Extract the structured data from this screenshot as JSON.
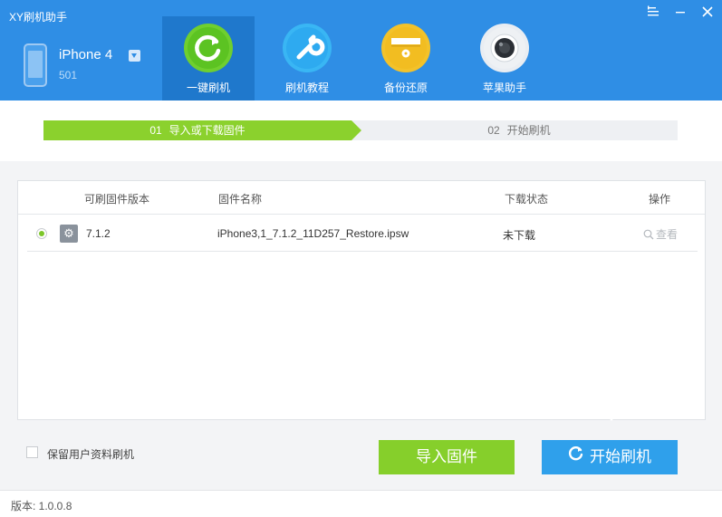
{
  "app": {
    "title": "XY刷机助手"
  },
  "device": {
    "name": "iPhone 4",
    "sub": "501"
  },
  "nav": [
    {
      "label": "一键刷机",
      "icon": "refresh-circle-icon",
      "color": "#6fcf2f",
      "active": true
    },
    {
      "label": "刷机教程",
      "icon": "wrench-icon",
      "color": "#39b6f4",
      "active": false
    },
    {
      "label": "备份还原",
      "icon": "folder-disc-icon",
      "color": "#f3c22a",
      "active": false
    },
    {
      "label": "苹果助手",
      "icon": "camera-lens-icon",
      "color": "#e9edf2",
      "active": false
    }
  ],
  "steps": {
    "step1": {
      "num": "01",
      "label": "导入或下载固件"
    },
    "step2": {
      "num": "02",
      "label": "开始刷机"
    }
  },
  "table": {
    "headers": {
      "version": "可刷固件版本",
      "name": "固件名称",
      "status": "下载状态",
      "action": "操作"
    },
    "rows": [
      {
        "version": "7.1.2",
        "name": "iPhone3,1_7.1.2_11D257_Restore.ipsw",
        "status": "未下载",
        "action": "查看",
        "selected": true
      }
    ]
  },
  "options": {
    "keep_data_label": "保留用户资料刷机"
  },
  "buttons": {
    "import": "导入固件",
    "flash": "开始刷机"
  },
  "footer": {
    "version": "版本: 1.0.0.8"
  },
  "colors": {
    "header": "#2f8ee5",
    "accent_green": "#86cf2b",
    "accent_blue": "#2fa0eb"
  }
}
